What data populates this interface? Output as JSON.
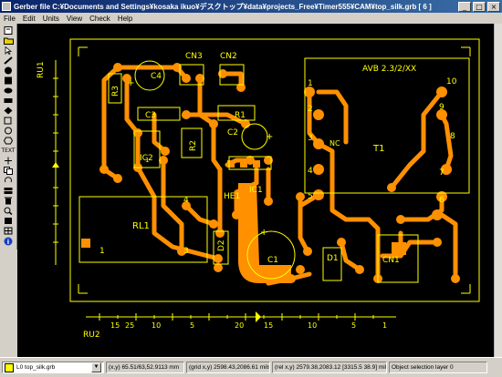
{
  "window": {
    "title": "Gerber file C:¥Documents and Settings¥kosaka ikuo¥デスクトップ¥data¥projects_Free¥Timer555¥CAM¥top_silk.grb [ 6 ]",
    "minimize": "_",
    "maximize": "□",
    "close": "×"
  },
  "menu": [
    "File",
    "Edit",
    "Units",
    "View",
    "Check",
    "Help"
  ],
  "toolbar_icons": [
    "open-file-icon",
    "open-folder-icon",
    "arrow-icon",
    "pencil-icon",
    "filled-circle-icon",
    "filled-square-icon",
    "filled-oval-icon",
    "filled-rect-icon",
    "diamond-icon",
    "square-outline-icon",
    "circle-outline-icon",
    "hexagon-icon",
    "text-tool-icon",
    "move-icon",
    "copy-icon",
    "rotate-icon",
    "layers-icon",
    "delete-icon",
    "zoom-icon",
    "pan-icon",
    "grid-icon",
    "info-icon"
  ],
  "toolbar_labels": {
    "text_tool": "TEXT",
    "info": "i"
  },
  "pcb": {
    "board_title": "AVB 2.3/2/XX",
    "labels": {
      "c4": "C4",
      "cn3": "CN3",
      "cn2": "CN2",
      "r3": "R3",
      "c3": "C3",
      "r1": "R1",
      "c2": "C2",
      "r2": "R2",
      "ic2": "IC2",
      "he1": "HE1",
      "ic1": "IC1",
      "rl1": "RL1",
      "c1": "C1",
      "d1": "D1",
      "d2": "D2",
      "t1": "T1",
      "cn1": "CN1",
      "nc": "NC",
      "ru1": "RU1",
      "ru2": "RU2"
    },
    "pin_numbers": [
      "1",
      "2",
      "3",
      "4",
      "5",
      "10",
      "9",
      "8",
      "7",
      "6"
    ],
    "ic2_pin": "1",
    "rl1_pins": [
      "4",
      "1",
      "3"
    ],
    "c1_polarity": "+",
    "c4_polarity": "+",
    "c2_polarity": "+",
    "ruler": {
      "numbers": [
        "15",
        "10",
        "5",
        "25",
        "20",
        "15",
        "10",
        "5",
        "1"
      ]
    },
    "colors": {
      "copper": "#ff9000",
      "silk": "#ffff00",
      "background": "#000000"
    }
  },
  "status": {
    "layer_id": "L0",
    "layer_name": "top_silk.grb",
    "xy": "(x,y) 65.51/63,52.9113 mm",
    "grid_xy": "(grid x,y) 2598.43,2086.61 mils",
    "rel_xy": "(rel x,y) 2579.38,2083.12 [3315.5 38.9] mils",
    "selection": "Object selection layer 0"
  }
}
